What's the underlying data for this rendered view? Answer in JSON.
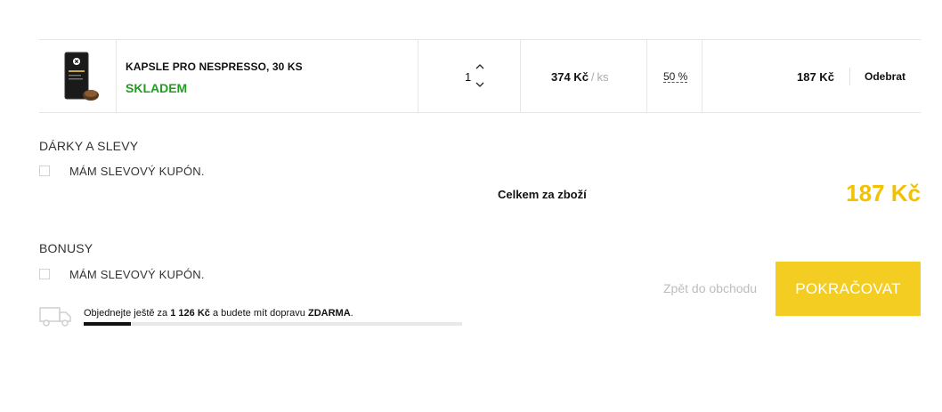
{
  "cart": {
    "item": {
      "name": "KAPSLE PRO NESPRESSO, 30 KS",
      "stock": "SKLADEM",
      "quantity": "1",
      "unit_price": "374 Kč",
      "unit_separator": "/",
      "unit": "ks",
      "discount": "50 %",
      "total": "187 Kč",
      "remove_label": "Odebrat",
      "image_icon": "coffee-capsule-box-icon"
    }
  },
  "gifts": {
    "title": "DÁRKY A SLEVY",
    "coupon_label": "MÁM SLEVOVÝ KUPÓN."
  },
  "bonus": {
    "title": "BONUSY",
    "coupon_label": "MÁM SLEVOVÝ KUPÓN."
  },
  "summary": {
    "label": "Celkem za zboží",
    "value": "187 Kč"
  },
  "actions": {
    "back_label": "Zpět do obchodu",
    "continue_label": "POKRAČOVAT"
  },
  "shipping": {
    "text_before": "Objednejte ještě za",
    "amount": "1 126 Kč",
    "text_middle": "a budete mít dopravu",
    "free_label": "ZDARMA",
    "text_end": ".",
    "progress_fraction": 0.125,
    "icon": "truck-icon"
  },
  "colors": {
    "accent": "#f4cd22",
    "sum_color": "#f2c200",
    "stock_green": "#1f9d1f"
  }
}
